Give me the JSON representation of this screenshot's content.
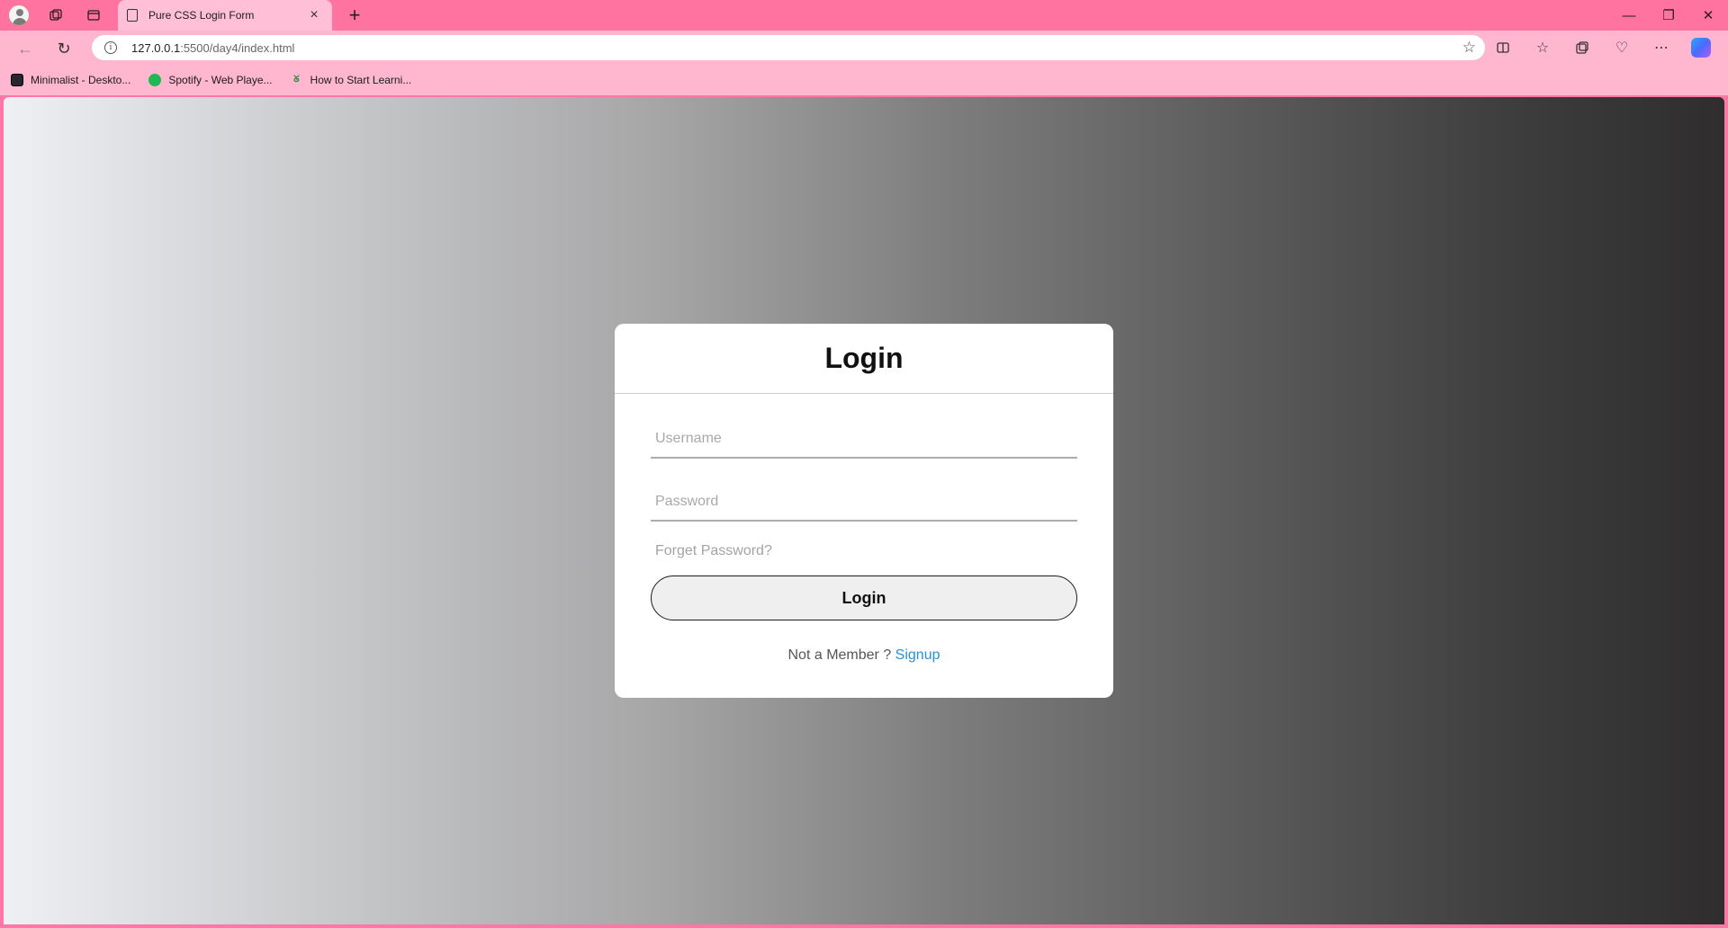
{
  "browser": {
    "tab_title": "Pure CSS Login Form",
    "tab_close": "×",
    "new_tab": "+",
    "url_host": "127.0.0.1",
    "url_path": ":5500/day4/index.html",
    "window_controls": {
      "minimize": "—",
      "restore": "❐",
      "close": "✕"
    },
    "bookmarks": [
      {
        "label": "Minimalist - Deskto...",
        "icon": "minimalist-favicon"
      },
      {
        "label": "Spotify - Web Playe...",
        "icon": "spotify-favicon"
      },
      {
        "label": "How to Start Learni...",
        "icon": "geeksforgeeks-favicon"
      }
    ]
  },
  "login": {
    "title": "Login",
    "username_placeholder": "Username",
    "password_placeholder": "Password",
    "forgot_label": "Forget Password?",
    "button_label": "Login",
    "signup_prompt": "Not a Member ?",
    "signup_link": "Signup"
  },
  "colors": {
    "tabbar": "#ff73a0",
    "toolbar": "#ffb6cf",
    "link": "#2691d9"
  }
}
